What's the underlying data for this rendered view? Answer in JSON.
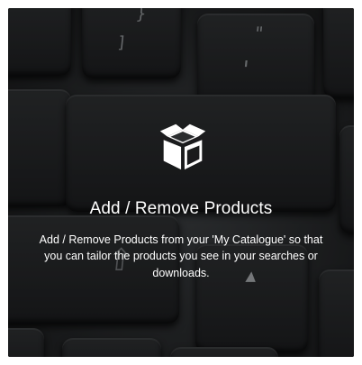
{
  "tile": {
    "icon": "open-box-icon",
    "title": "Add / Remove Products",
    "description": "Add / Remove Products from your 'My Catalogue' so that you can tailor the products you see in your searches or downloads."
  },
  "keyboard": {
    "glyphs": [
      "}",
      "]",
      "\"",
      "'",
      "⇧",
      "▲"
    ]
  },
  "colors": {
    "text": "#ffffff",
    "keys": "#242628",
    "icon": "#ffffff"
  }
}
